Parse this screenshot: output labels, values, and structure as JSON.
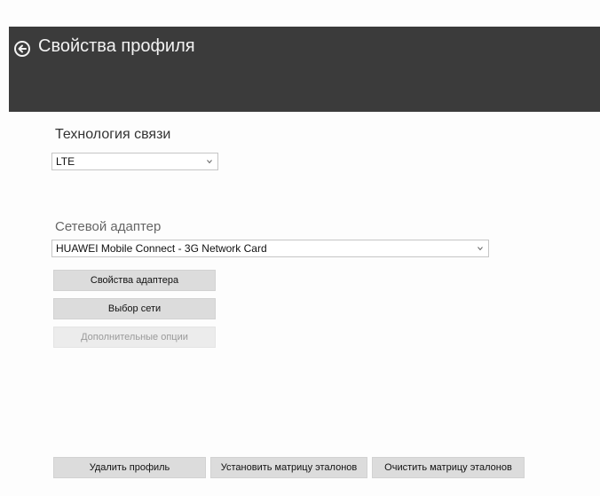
{
  "header": {
    "title": "Свойства профиля",
    "back_icon": "back-arrow-circle-icon"
  },
  "technology": {
    "label": "Технология связи",
    "selected": "LTE"
  },
  "adapter": {
    "label": "Сетевой адаптер",
    "selected": "HUAWEI Mobile Connect - 3G Network Card",
    "buttons": {
      "properties": "Свойства адаптера",
      "network_select": "Выбор сети",
      "extra_options": "Дополнительные опции"
    }
  },
  "footer": {
    "delete_profile": "Удалить профиль",
    "set_matrix": "Установить матрицу эталонов",
    "clear_matrix": "Очистить матрицу эталонов"
  },
  "colors": {
    "header_bg": "#3b3b3b",
    "button_bg": "#dcdcdc",
    "disabled_text": "#9a9a9a"
  }
}
